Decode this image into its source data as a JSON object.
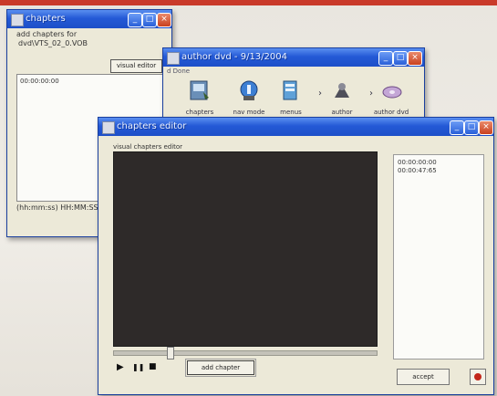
{
  "colors": {
    "titlebar": "#2459d6",
    "video_bg": "#2e2a29",
    "brand_red": "#c93a2a"
  },
  "chapters_window": {
    "title": "chapters",
    "add_label": "add chapters for",
    "source_file": "dvd\\VTS_02_0.VOB",
    "visual_editor_button": "visual editor",
    "list_items": [
      "00:00:00:00"
    ],
    "format_hint": "(hh:mm:ss) HH:MM:SS"
  },
  "author_window": {
    "title": "author dvd - 9/13/2004",
    "menu_partial": "d  Done",
    "tools": [
      {
        "label": "chapters",
        "icon": "chapters-icon"
      },
      {
        "label": "nav mode",
        "icon": "nav-mode-icon"
      },
      {
        "label": "menus",
        "icon": "menus-icon"
      },
      {
        "label": "author",
        "icon": "author-icon"
      },
      {
        "label": "author dvd",
        "icon": "author-dvd-icon"
      }
    ]
  },
  "editor_window": {
    "title": "chapters editor",
    "section_label": "visual chapters editor",
    "chapter_list": [
      "00:00:00:00",
      "00:00:47:65"
    ],
    "controls": {
      "play": "▶",
      "pause": "❚❚",
      "stop": "■"
    },
    "add_chapter_button": "add chapter",
    "accept_button": "accept",
    "seek_progress": 0.2
  },
  "window_buttons": {
    "minimize": "_",
    "maximize": "□",
    "close": "×"
  }
}
